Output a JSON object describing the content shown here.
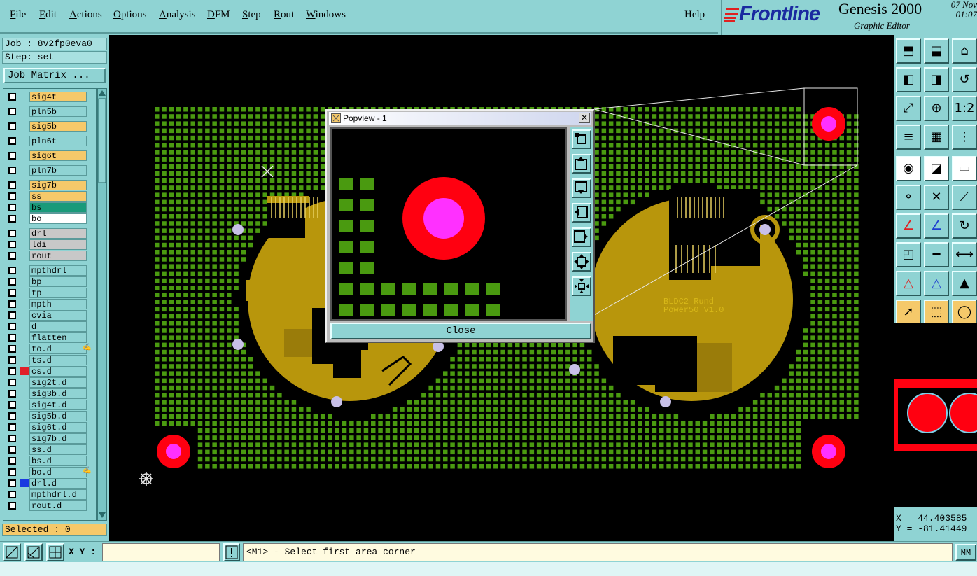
{
  "menu": {
    "items": [
      {
        "label": "File",
        "u": "F",
        "rest": "ile"
      },
      {
        "label": "Edit",
        "u": "E",
        "rest": "dit"
      },
      {
        "label": "Actions",
        "u": "A",
        "rest": "ctions"
      },
      {
        "label": "Options",
        "u": "O",
        "rest": "ptions"
      },
      {
        "label": "Analysis",
        "u": "A",
        "rest": "nalysis"
      },
      {
        "label": "DFM",
        "u": "D",
        "rest": "FM"
      },
      {
        "label": "Step",
        "u": "S",
        "rest": "tep"
      },
      {
        "label": "Rout",
        "u": "R",
        "rest": "out"
      },
      {
        "label": "Windows",
        "u": "W",
        "rest": "indows"
      }
    ],
    "help": "Help"
  },
  "brand": {
    "logo": "Frontline",
    "title": "Genesis 2000",
    "subtitle": "Graphic Editor",
    "date": "07 Nov",
    "time": "01:07"
  },
  "job": {
    "job_line": "Job : 8v2fp0eva0",
    "step_line": "Step: set",
    "matrix_button": "Job Matrix ..."
  },
  "layers": [
    {
      "name": "sig4t",
      "color": "#f5c96a",
      "swatch": ""
    },
    {
      "name": "pln5b",
      "color": "#8fd3d3",
      "swatch": ""
    },
    {
      "name": "sig5b",
      "color": "#f5c96a",
      "swatch": ""
    },
    {
      "name": "pln6t",
      "color": "#8fd3d3",
      "swatch": ""
    },
    {
      "name": "sig6t",
      "color": "#f5c96a",
      "swatch": ""
    },
    {
      "name": "pln7b",
      "color": "#8fd3d3",
      "swatch": ""
    },
    {
      "name": "sig7b",
      "color": "#f5c96a",
      "swatch": ""
    },
    {
      "name": "ss",
      "color": "#f5c96a",
      "swatch": ""
    },
    {
      "name": "bs",
      "color": "#1a9a7a",
      "swatch": ""
    },
    {
      "name": "bo",
      "color": "#ffffff",
      "swatch": ""
    },
    {
      "name": "drl",
      "color": "#c8c8c8",
      "swatch": ""
    },
    {
      "name": "ldi",
      "color": "#c8c8c8",
      "swatch": ""
    },
    {
      "name": "rout",
      "color": "#c8c8c8",
      "swatch": ""
    },
    {
      "name": "mpthdrl",
      "color": "#8fd3d3",
      "swatch": ""
    },
    {
      "name": "bp",
      "color": "#8fd3d3",
      "swatch": ""
    },
    {
      "name": "tp",
      "color": "#8fd3d3",
      "swatch": ""
    },
    {
      "name": "mpth",
      "color": "#8fd3d3",
      "swatch": ""
    },
    {
      "name": "cvia",
      "color": "#8fd3d3",
      "swatch": ""
    },
    {
      "name": "d",
      "color": "#8fd3d3",
      "swatch": ""
    },
    {
      "name": "flatten",
      "color": "#8fd3d3",
      "swatch": ""
    },
    {
      "name": "to.d",
      "color": "#8fd3d3",
      "swatch": "",
      "mark": "✍"
    },
    {
      "name": "ts.d",
      "color": "#8fd3d3",
      "swatch": ""
    },
    {
      "name": "cs.d",
      "color": "#8fd3d3",
      "swatch": "#e0202a"
    },
    {
      "name": "sig2t.d",
      "color": "#8fd3d3",
      "swatch": ""
    },
    {
      "name": "sig3b.d",
      "color": "#8fd3d3",
      "swatch": ""
    },
    {
      "name": "sig4t.d",
      "color": "#8fd3d3",
      "swatch": ""
    },
    {
      "name": "sig5b.d",
      "color": "#8fd3d3",
      "swatch": ""
    },
    {
      "name": "sig6t.d",
      "color": "#8fd3d3",
      "swatch": ""
    },
    {
      "name": "sig7b.d",
      "color": "#8fd3d3",
      "swatch": ""
    },
    {
      "name": "ss.d",
      "color": "#8fd3d3",
      "swatch": ""
    },
    {
      "name": "bs.d",
      "color": "#8fd3d3",
      "swatch": ""
    },
    {
      "name": "bo.d",
      "color": "#8fd3d3",
      "swatch": "",
      "mark": "✍"
    },
    {
      "name": "drl.d",
      "color": "#8fd3d3",
      "swatch": "#1a3ae0"
    },
    {
      "name": "mpthdrl.d",
      "color": "#8fd3d3",
      "swatch": ""
    },
    {
      "name": "rout.d",
      "color": "#8fd3d3",
      "swatch": ""
    }
  ],
  "selected": "Selected : 0",
  "board": {
    "silk_text_1": "BLDC2 Rund",
    "silk_text_2": "Power50 V1.0",
    "pad_color": "#4a9a10",
    "copper_color": "#b8960c",
    "fiducial_outer": "#ff0010",
    "fiducial_inner": "#ff30ff"
  },
  "popview": {
    "title": "Popview - 1",
    "close_label": "Close"
  },
  "coords": {
    "x": "X =  44.403585",
    "y": "Y = -81.41449"
  },
  "status": {
    "xy_label": "X Y :",
    "xy_value": "",
    "message": "<M1> - Select first area corner",
    "units": "MM"
  }
}
